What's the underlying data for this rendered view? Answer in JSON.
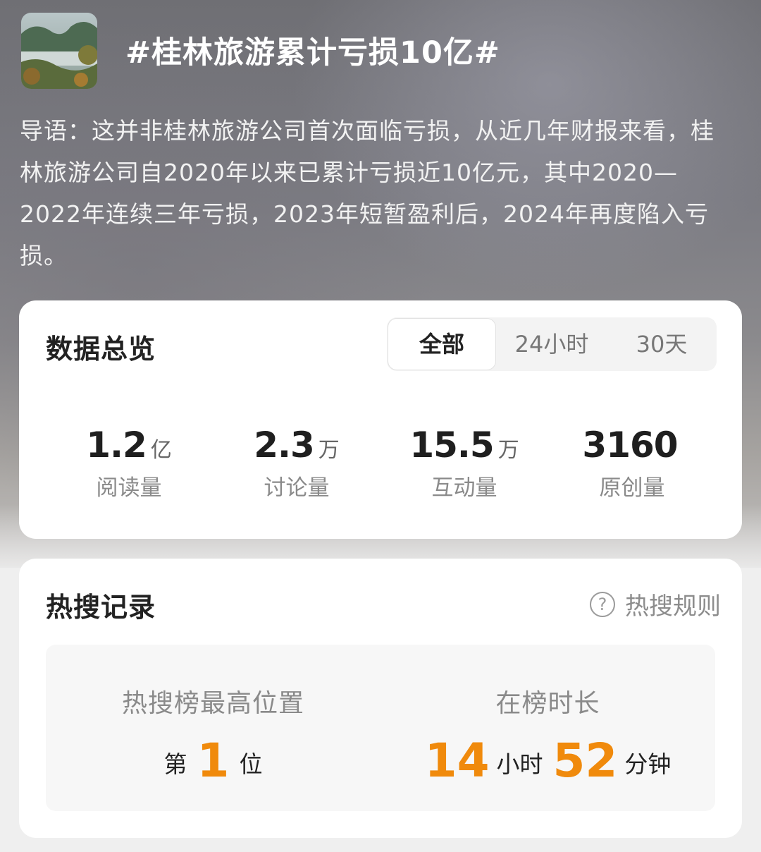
{
  "topic": {
    "title": "#桂林旅游累计亏损10亿#",
    "intro": "导语：这并非桂林旅游公司首次面临亏损，从近几年财报来看，桂林旅游公司自2020年以来已累计亏损近10亿元，其中2020—2022年连续三年亏损，2023年短暂盈利后，2024年再度陷入亏损。"
  },
  "overview": {
    "title": "数据总览",
    "tabs": [
      "全部",
      "24小时",
      "30天"
    ],
    "active_tab": "全部",
    "stats": [
      {
        "value": "1.2",
        "unit": "亿",
        "label": "阅读量"
      },
      {
        "value": "2.3",
        "unit": "万",
        "label": "讨论量"
      },
      {
        "value": "15.5",
        "unit": "万",
        "label": "互动量"
      },
      {
        "value": "3160",
        "unit": "",
        "label": "原创量"
      }
    ]
  },
  "hot_search": {
    "title": "热搜记录",
    "rules_label": "热搜规则",
    "highest_position": {
      "label": "热搜榜最高位置",
      "prefix": "第",
      "value": "1",
      "suffix": "位"
    },
    "duration": {
      "label": "在榜时长",
      "hours": "14",
      "hours_unit": "小时",
      "minutes": "52",
      "minutes_unit": "分钟"
    }
  },
  "colors": {
    "accent": "#f08a0c",
    "card_bg": "#ffffff",
    "page_bg": "#efefef"
  }
}
